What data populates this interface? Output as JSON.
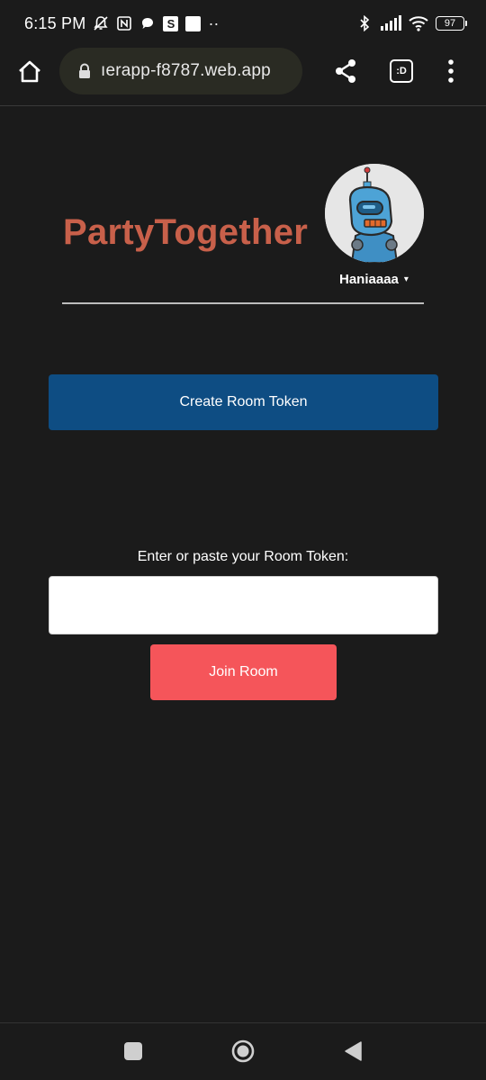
{
  "status_bar": {
    "time": "6:15 PM",
    "icons": [
      "bell-off-icon",
      "nfc-icon",
      "chat-icon",
      "s-app-icon",
      "white-square-icon",
      "more-dots-icon"
    ],
    "s_app_glyph": "S",
    "dots": "··",
    "right_icons": [
      "bluetooth-icon",
      "signal-icon",
      "wifi-icon",
      "battery-icon"
    ],
    "battery_level": "97"
  },
  "browser": {
    "url": "ıerapp-f8787.web.app",
    "tabs_glyph": ":D",
    "icons": [
      "home-icon",
      "lock-icon",
      "share-icon",
      "tabs-icon",
      "more-vert-icon"
    ]
  },
  "header": {
    "title": "PartyTogether",
    "username": "Haniaaaa",
    "dropdown_caret": "▾",
    "avatar": "robot-avatar",
    "title_color": "#c8604a"
  },
  "actions": {
    "create_label": "Create Room Token",
    "create_color": "#0e4d83",
    "token_label": "Enter or paste your Room Token:",
    "token_value": "",
    "join_label": "Join Room",
    "join_color": "#f5555a"
  },
  "nav": {
    "icons": [
      "recents-square-icon",
      "home-circle-icon",
      "back-triangle-icon"
    ]
  }
}
